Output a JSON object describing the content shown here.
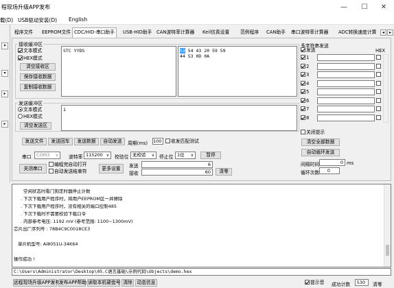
{
  "window": {
    "title": "程现场升级APP发布",
    "min": "—",
    "max": "☐",
    "close": "✕"
  },
  "menu": [
    "载(D)",
    "USB驱动安装(D)",
    "English"
  ],
  "left_strip": [
    "▾",
    "▾",
    "▸",
    "▸"
  ],
  "tabs": [
    "程序文件",
    "EEPROM文件",
    "CDC/HID-串口助手",
    "USB-HID助手",
    "CAN波特率计算器",
    "Keil仿真设置",
    "范例程序",
    "CAN助手",
    "串口波特率计算器",
    "ADC转换速度计算"
  ],
  "tab_nav": [
    "◂",
    "▸"
  ],
  "recv": {
    "group_title": "接收缓冲区",
    "text_mode": "文本模式",
    "hex_mode": "HEX模式",
    "clear_btn": "清空接收区",
    "save_btn": "保存接收数据",
    "copy_btn": "复制接收数据",
    "text_content": "STC YYDS",
    "hex_line1_sel": "53",
    "hex_line1_rest": " 54 43 20 59 59",
    "hex_line2": "44 53 0D 0A"
  },
  "send": {
    "group_title": "发送缓冲区",
    "text_mode": "文本模式",
    "hex_mode": "HEX模式",
    "clear_btn": "清空发送区",
    "content": "1"
  },
  "action_row": {
    "send_file": "发送文件",
    "send_return": "发送回车",
    "send_data": "发送数据",
    "auto_send": "自动发送",
    "period_label": "周期(ms)",
    "period_value": "100",
    "match_test": "收发匹配测试"
  },
  "port_row": {
    "port_label": "串口",
    "port_value": "COM3",
    "baud_label": "波特率",
    "baud_value": "115200",
    "parity_label": "校验位",
    "parity_value": "无校验",
    "stop_label": "停止位",
    "stop_value": "1位",
    "pause_btn": "暂停"
  },
  "bottom_ctrl": {
    "close_port": "关闭串口",
    "auto_open": "编程完自动打开",
    "auto_close": "自动发送结束符",
    "more_settings": "更多设置",
    "send_label": "发送",
    "send_count": "6",
    "recv_label": "接收",
    "recv_count": "60",
    "clear_count": "清零"
  },
  "multi": {
    "group_title": "多字符串发送",
    "send_header": "发送",
    "hex_header": "HEX",
    "rows": [
      {
        "n": "1",
        "checked": true
      },
      {
        "n": "2",
        "checked": true
      },
      {
        "n": "3",
        "checked": true
      },
      {
        "n": "4",
        "checked": true
      },
      {
        "n": "5",
        "checked": true
      },
      {
        "n": "6",
        "checked": true
      },
      {
        "n": "7",
        "checked": true
      },
      {
        "n": "8",
        "checked": true
      }
    ],
    "close_tip": "关闭提示",
    "clear_all": "清空全部数据",
    "auto_loop": "自动循环发送",
    "interval_label": "间隔时间",
    "interval_value": "0",
    "interval_unit": "ms",
    "loop_label": "循环次数",
    "loop_value": "0"
  },
  "log": [
    "空闲状态时看门狗定时器停止计数",
    ". 下次下载用户程序时，将用户EEPROM区一并擦除",
    ". 下次下载用户程序时，没有相关的端口控制485",
    ". 下次下载时不需要校验下载口令",
    ". 内部参考电压: 1192 mV (参考范围: 1100~1300mV)",
    "芯片出厂序列号 : 78B4C9C0018CE3",
    "",
    "单片机型号: AI8051U-34K64",
    "",
    "操作成功 !"
  ],
  "path": "C:\\Users\\Administrator\\Desktop\\05.C语言基础\\示例代码\\Objects\\demo.hex",
  "bottom_bar": {
    "btn1": "远程现场升级APP发布",
    "btn2": "发布APP帮助",
    "btn3": "读取本机硬盘号",
    "btn4": "清除",
    "btn5": "动态信息",
    "tip": "提示音",
    "success_label": "成功计数",
    "success_value": "530",
    "clear": "清零"
  },
  "colors": {
    "selection": "#3399ff",
    "window_bg": "#f0f0f0",
    "button_bg": "#e1e1e1",
    "field_border": "#7a7a7a"
  }
}
